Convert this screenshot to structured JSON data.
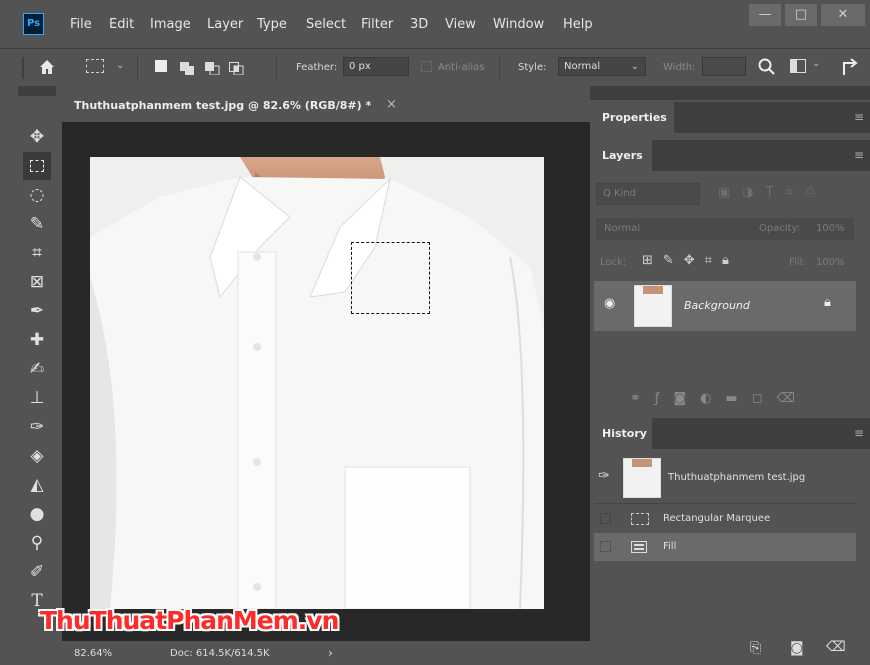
{
  "app": {
    "logo": "Ps"
  },
  "menu": [
    "File",
    "Edit",
    "Image",
    "Layer",
    "Type",
    "Select",
    "Filter",
    "3D",
    "View",
    "Window",
    "Help"
  ],
  "window_controls": {
    "minimize": "—",
    "maximize": "□",
    "close": "✕"
  },
  "options": {
    "feather_label": "Feather:",
    "feather_value": "0 px",
    "antialias_label": "Anti-alias",
    "style_label": "Style:",
    "style_value": "Normal",
    "width_label": "Width:"
  },
  "document": {
    "tab_title": "Thuthuatphanmem test.jpg @ 82.6% (RGB/8#) *",
    "close": "×",
    "zoom": "82.64%",
    "doc_size": "Doc: 614.5K/614.5K",
    "status_arrow": "›"
  },
  "watermark": "ThuThuatPhanMem.vn",
  "properties_panel": {
    "title": "Properties"
  },
  "layers_panel": {
    "title": "Layers",
    "kind_label": "Q Kind",
    "blend_mode": "Normal",
    "opacity_label": "Opacity:",
    "opacity_value": "100%",
    "lock_label": "Lock:",
    "fill_label": "Fill:",
    "fill_value": "100%",
    "layers": [
      {
        "name": "Background"
      }
    ]
  },
  "history_panel": {
    "title": "History",
    "snapshot": "Thuthuatphanmem test.jpg",
    "states": [
      "Rectangular Marquee",
      "Fill"
    ]
  },
  "colors": {
    "ui_bg": "#535353",
    "ui_dark": "#3e3e3e",
    "canvas_bg": "#282828",
    "accent": "#31a8ff",
    "watermark_red": "#ff2a2a"
  }
}
